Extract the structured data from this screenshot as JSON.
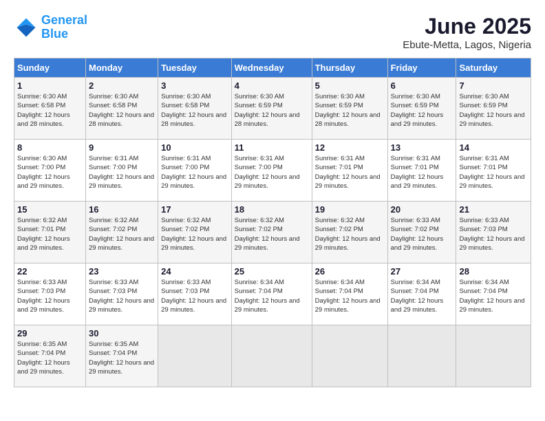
{
  "logo": {
    "line1": "General",
    "line2": "Blue"
  },
  "title": "June 2025",
  "location": "Ebute-Metta, Lagos, Nigeria",
  "days_of_week": [
    "Sunday",
    "Monday",
    "Tuesday",
    "Wednesday",
    "Thursday",
    "Friday",
    "Saturday"
  ],
  "weeks": [
    [
      {
        "day": "1",
        "sunrise": "6:30 AM",
        "sunset": "6:58 PM",
        "daylight": "12 hours and 28 minutes."
      },
      {
        "day": "2",
        "sunrise": "6:30 AM",
        "sunset": "6:58 PM",
        "daylight": "12 hours and 28 minutes."
      },
      {
        "day": "3",
        "sunrise": "6:30 AM",
        "sunset": "6:58 PM",
        "daylight": "12 hours and 28 minutes."
      },
      {
        "day": "4",
        "sunrise": "6:30 AM",
        "sunset": "6:59 PM",
        "daylight": "12 hours and 28 minutes."
      },
      {
        "day": "5",
        "sunrise": "6:30 AM",
        "sunset": "6:59 PM",
        "daylight": "12 hours and 28 minutes."
      },
      {
        "day": "6",
        "sunrise": "6:30 AM",
        "sunset": "6:59 PM",
        "daylight": "12 hours and 29 minutes."
      },
      {
        "day": "7",
        "sunrise": "6:30 AM",
        "sunset": "6:59 PM",
        "daylight": "12 hours and 29 minutes."
      }
    ],
    [
      {
        "day": "8",
        "sunrise": "6:30 AM",
        "sunset": "7:00 PM",
        "daylight": "12 hours and 29 minutes."
      },
      {
        "day": "9",
        "sunrise": "6:31 AM",
        "sunset": "7:00 PM",
        "daylight": "12 hours and 29 minutes."
      },
      {
        "day": "10",
        "sunrise": "6:31 AM",
        "sunset": "7:00 PM",
        "daylight": "12 hours and 29 minutes."
      },
      {
        "day": "11",
        "sunrise": "6:31 AM",
        "sunset": "7:00 PM",
        "daylight": "12 hours and 29 minutes."
      },
      {
        "day": "12",
        "sunrise": "6:31 AM",
        "sunset": "7:01 PM",
        "daylight": "12 hours and 29 minutes."
      },
      {
        "day": "13",
        "sunrise": "6:31 AM",
        "sunset": "7:01 PM",
        "daylight": "12 hours and 29 minutes."
      },
      {
        "day": "14",
        "sunrise": "6:31 AM",
        "sunset": "7:01 PM",
        "daylight": "12 hours and 29 minutes."
      }
    ],
    [
      {
        "day": "15",
        "sunrise": "6:32 AM",
        "sunset": "7:01 PM",
        "daylight": "12 hours and 29 minutes."
      },
      {
        "day": "16",
        "sunrise": "6:32 AM",
        "sunset": "7:02 PM",
        "daylight": "12 hours and 29 minutes."
      },
      {
        "day": "17",
        "sunrise": "6:32 AM",
        "sunset": "7:02 PM",
        "daylight": "12 hours and 29 minutes."
      },
      {
        "day": "18",
        "sunrise": "6:32 AM",
        "sunset": "7:02 PM",
        "daylight": "12 hours and 29 minutes."
      },
      {
        "day": "19",
        "sunrise": "6:32 AM",
        "sunset": "7:02 PM",
        "daylight": "12 hours and 29 minutes."
      },
      {
        "day": "20",
        "sunrise": "6:33 AM",
        "sunset": "7:02 PM",
        "daylight": "12 hours and 29 minutes."
      },
      {
        "day": "21",
        "sunrise": "6:33 AM",
        "sunset": "7:03 PM",
        "daylight": "12 hours and 29 minutes."
      }
    ],
    [
      {
        "day": "22",
        "sunrise": "6:33 AM",
        "sunset": "7:03 PM",
        "daylight": "12 hours and 29 minutes."
      },
      {
        "day": "23",
        "sunrise": "6:33 AM",
        "sunset": "7:03 PM",
        "daylight": "12 hours and 29 minutes."
      },
      {
        "day": "24",
        "sunrise": "6:33 AM",
        "sunset": "7:03 PM",
        "daylight": "12 hours and 29 minutes."
      },
      {
        "day": "25",
        "sunrise": "6:34 AM",
        "sunset": "7:04 PM",
        "daylight": "12 hours and 29 minutes."
      },
      {
        "day": "26",
        "sunrise": "6:34 AM",
        "sunset": "7:04 PM",
        "daylight": "12 hours and 29 minutes."
      },
      {
        "day": "27",
        "sunrise": "6:34 AM",
        "sunset": "7:04 PM",
        "daylight": "12 hours and 29 minutes."
      },
      {
        "day": "28",
        "sunrise": "6:34 AM",
        "sunset": "7:04 PM",
        "daylight": "12 hours and 29 minutes."
      }
    ],
    [
      {
        "day": "29",
        "sunrise": "6:35 AM",
        "sunset": "7:04 PM",
        "daylight": "12 hours and 29 minutes."
      },
      {
        "day": "30",
        "sunrise": "6:35 AM",
        "sunset": "7:04 PM",
        "daylight": "12 hours and 29 minutes."
      },
      null,
      null,
      null,
      null,
      null
    ]
  ]
}
